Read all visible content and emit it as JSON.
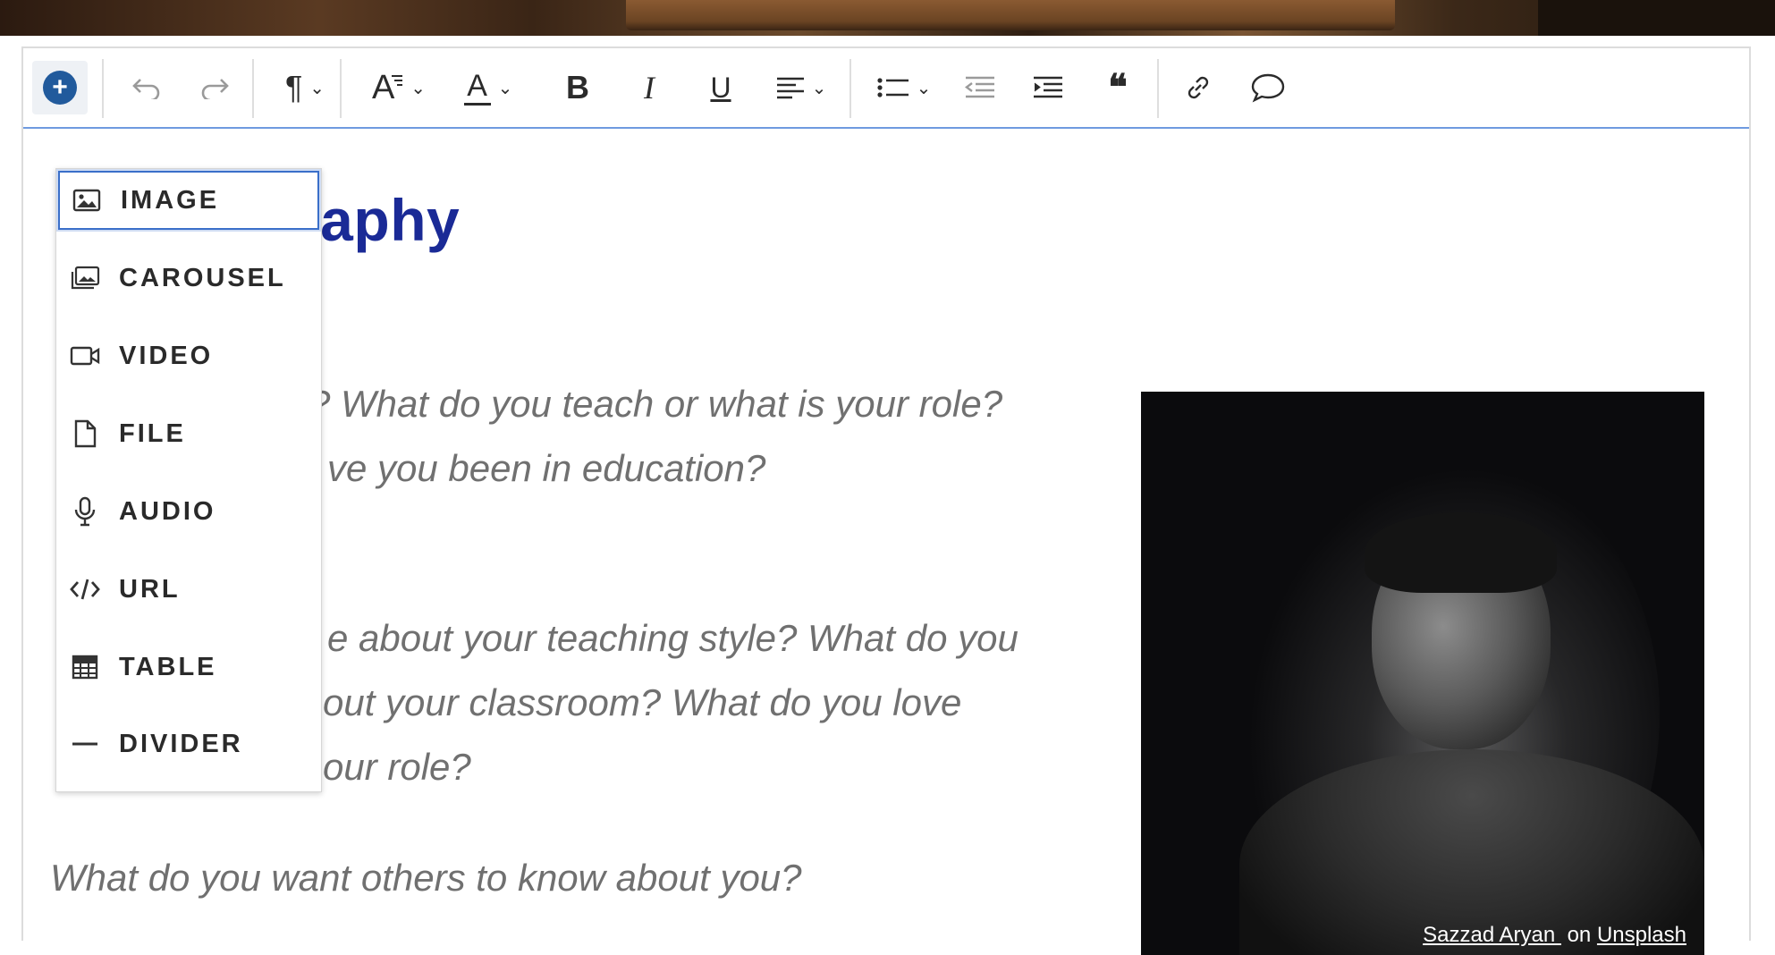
{
  "toolbar": {
    "insert_symbol": "+",
    "undo_symbol": "↶",
    "redo_symbol": "↷",
    "paragraph_symbol": "¶",
    "font_size_symbol": "A",
    "font_color_symbol": "A",
    "bold_symbol": "B",
    "italic_symbol": "I",
    "underline_symbol": "U",
    "chevron": "⌄",
    "quote_symbol": "❝"
  },
  "insert_menu": {
    "items": [
      {
        "label": "IMAGE",
        "icon": "image-icon",
        "active": true
      },
      {
        "label": "CAROUSEL",
        "icon": "carousel-icon"
      },
      {
        "label": "VIDEO",
        "icon": "video-icon"
      },
      {
        "label": "FILE",
        "icon": "file-icon"
      },
      {
        "label": "AUDIO",
        "icon": "microphone-icon"
      },
      {
        "label": "URL",
        "icon": "code-icon"
      },
      {
        "label": "TABLE",
        "icon": "table-icon"
      },
      {
        "label": "DIVIDER",
        "icon": "divider-icon"
      }
    ]
  },
  "content": {
    "heading_visible": "raphy",
    "para1_line1": "? What do you teach or what is your role?",
    "para1_line2": "ve you been in education?",
    "para2_line1": "e about your teaching style? What do you",
    "para2_line2": "out your classroom? What do you love",
    "para2_line3": "our role?",
    "para3": "What do you want others to know about you?"
  },
  "photo": {
    "credit_author": "Sazzad Aryan ",
    "credit_on": " on ",
    "credit_site": "Unsplash "
  },
  "colors": {
    "heading": "#1a2a96",
    "accent": "#215a9c",
    "focus_border": "#3a6fc9"
  }
}
